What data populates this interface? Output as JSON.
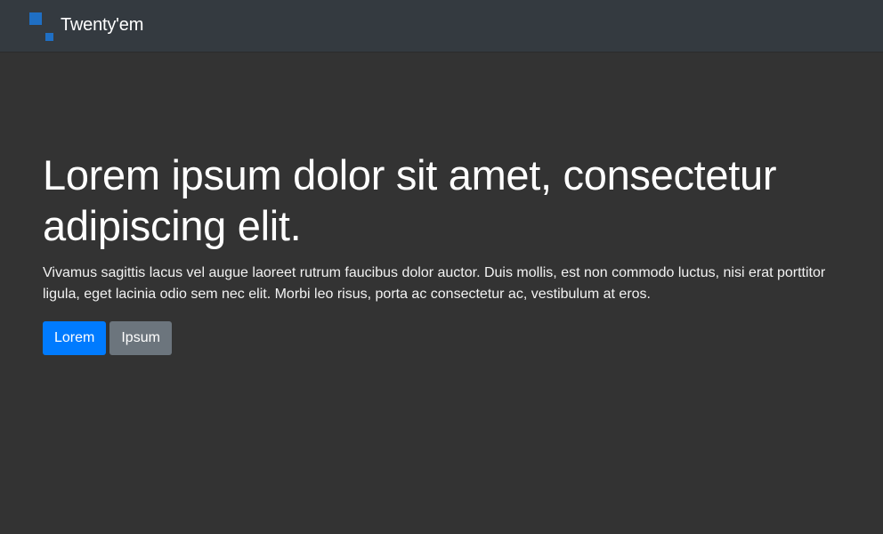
{
  "navbar": {
    "brand_text": "Twenty'em",
    "logo_icon": "twentyem-logo-icon",
    "logo_color": "#1f6fc4",
    "background": "#343a40"
  },
  "hero": {
    "title": "Lorem ipsum dolor sit amet, consectetur adipiscing elit.",
    "text": "Vivamus sagittis lacus vel augue laoreet rutrum faucibus dolor auctor. Duis mollis, est non commodo luctus, nisi erat porttitor ligula, eget lacinia odio sem nec elit. Morbi leo risus, porta ac consectetur ac, vestibulum at eros.",
    "primary_button": "Lorem",
    "secondary_button": "Ipsum"
  },
  "colors": {
    "page_background": "#333333",
    "primary": "#007bff",
    "secondary": "#6c757d"
  }
}
